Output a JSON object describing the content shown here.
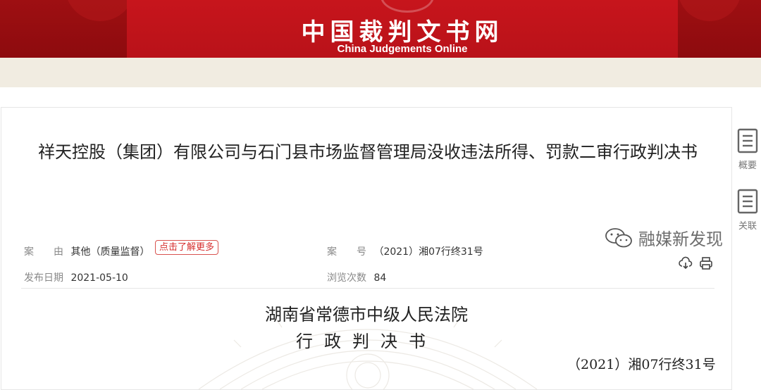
{
  "header": {
    "title_cn": "中国裁判文书网",
    "title_en": "China Judgements Online"
  },
  "document": {
    "title": "祥天控股（集团）有限公司与石门县市场监督管理局没收违法所得、罚款二审行政判决书",
    "cause_label": "案　　由",
    "cause_value": "其他（质量监督）",
    "learn_more": "点击了解更多",
    "case_no_label": "案　　号",
    "case_no_value": "（2021）湘07行终31号",
    "publish_label": "发布日期",
    "publish_value": "2021-05-10",
    "views_label": "浏览次数",
    "views_value": "84",
    "court": "湖南省常德市中级人民法院",
    "doc_type": "行政判决书",
    "case_no_line": "（2021）湘07行终31号"
  },
  "side_tools": [
    {
      "label": "概要",
      "icon": "summary-icon"
    },
    {
      "label": "关联",
      "icon": "related-icon"
    }
  ],
  "watermark": {
    "text": "融媒新发现",
    "icon": "wechat-icon"
  },
  "actions": {
    "download_icon": "cloud-download-icon",
    "print_icon": "printer-icon"
  },
  "colors": {
    "header_red": "#b91219",
    "header_dark": "#8d0b0e",
    "beige": "#f1ece1",
    "tag_red": "#d62f2f"
  }
}
